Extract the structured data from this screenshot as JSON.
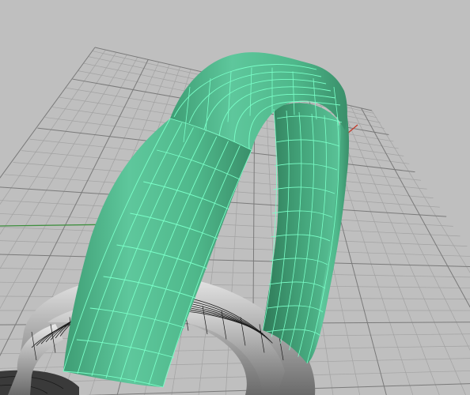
{
  "viewport": {
    "projection": "perspective",
    "background_color": "#bfbfbf",
    "grid": {
      "visible": true,
      "minor_line_color": "#a2a2a2",
      "major_line_color": "#7a7a7a"
    },
    "axes": {
      "x_axis_color": "#c43a2a",
      "y_axis_color": "#3f8f3f"
    }
  },
  "scene": {
    "objects": [
      {
        "name": "large-ring",
        "selected": true,
        "surface_color": "#5ec79c",
        "isocurve_color": "#7affc8"
      },
      {
        "name": "lower-ring",
        "selected": false,
        "surface_color": "#b9b9b9",
        "isocurve_color": "#1a1a1a"
      },
      {
        "name": "dark-ring",
        "selected": false,
        "surface_color": "#3a3a3a",
        "isocurve_color": "#1a1a1a"
      }
    ]
  }
}
